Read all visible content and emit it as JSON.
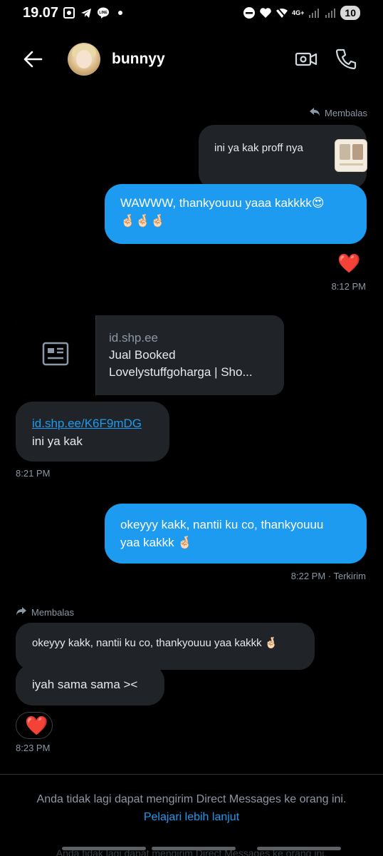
{
  "status_bar": {
    "time": "19.07",
    "network": "4G+",
    "battery": "10",
    "icons": [
      "screen-record-icon",
      "telegram-icon",
      "line-icon",
      "dot-icon",
      "dnd-icon",
      "heart-icon",
      "wifi-off-icon",
      "signal-icon",
      "battery-icon"
    ]
  },
  "header": {
    "name": "bunnyy",
    "icons": [
      "back-arrow-icon",
      "video-call-icon",
      "phone-icon"
    ]
  },
  "messages": {
    "reply_label_1": "Membalas",
    "quoted_1": "ini ya kak proff nya",
    "msg_1": "WAWWW, thankyouuu yaaa kakkkk😍",
    "msg_1_emojis": "🤞🏻🤞🏻🤞🏻",
    "reaction_1": "❤️",
    "time_1": "8:12 PM",
    "card_domain": "id.shp.ee",
    "card_title_1": "Jual Booked",
    "card_title_2": "Lovelystuffgoharga | Sho...",
    "link_text": "id.shp.ee/K6F9mDG",
    "msg_2": "ini ya kak",
    "time_2": "8:21 PM",
    "msg_3_line1": "okeyyy kakk, nantii ku co, thankyouuu",
    "msg_3_line2": "yaa kakkk 🤞🏻",
    "time_3": "8:22 PM · Terkirim",
    "reply_label_2": "Membalas",
    "quoted_2": "okeyyy kakk, nantii ku co, thankyouuu yaa kakkk 🤞🏻",
    "msg_4": "iyah sama sama ><",
    "reaction_2": "❤️",
    "time_4": "8:23 PM"
  },
  "footer": {
    "notice": "Anda tidak lagi dapat mengirim Direct Messages ke orang ini.",
    "learn_more": "Pelajari lebih lanjut",
    "ghost_text": "Anda tidak lagi dapat mengirim Direct Messages ke orang ini."
  },
  "colors": {
    "background": "#000000",
    "accent_blue": "#1d9bf0",
    "bubble_grey": "#202327",
    "muted_text": "#8b98a5",
    "heart": "#f91880"
  }
}
